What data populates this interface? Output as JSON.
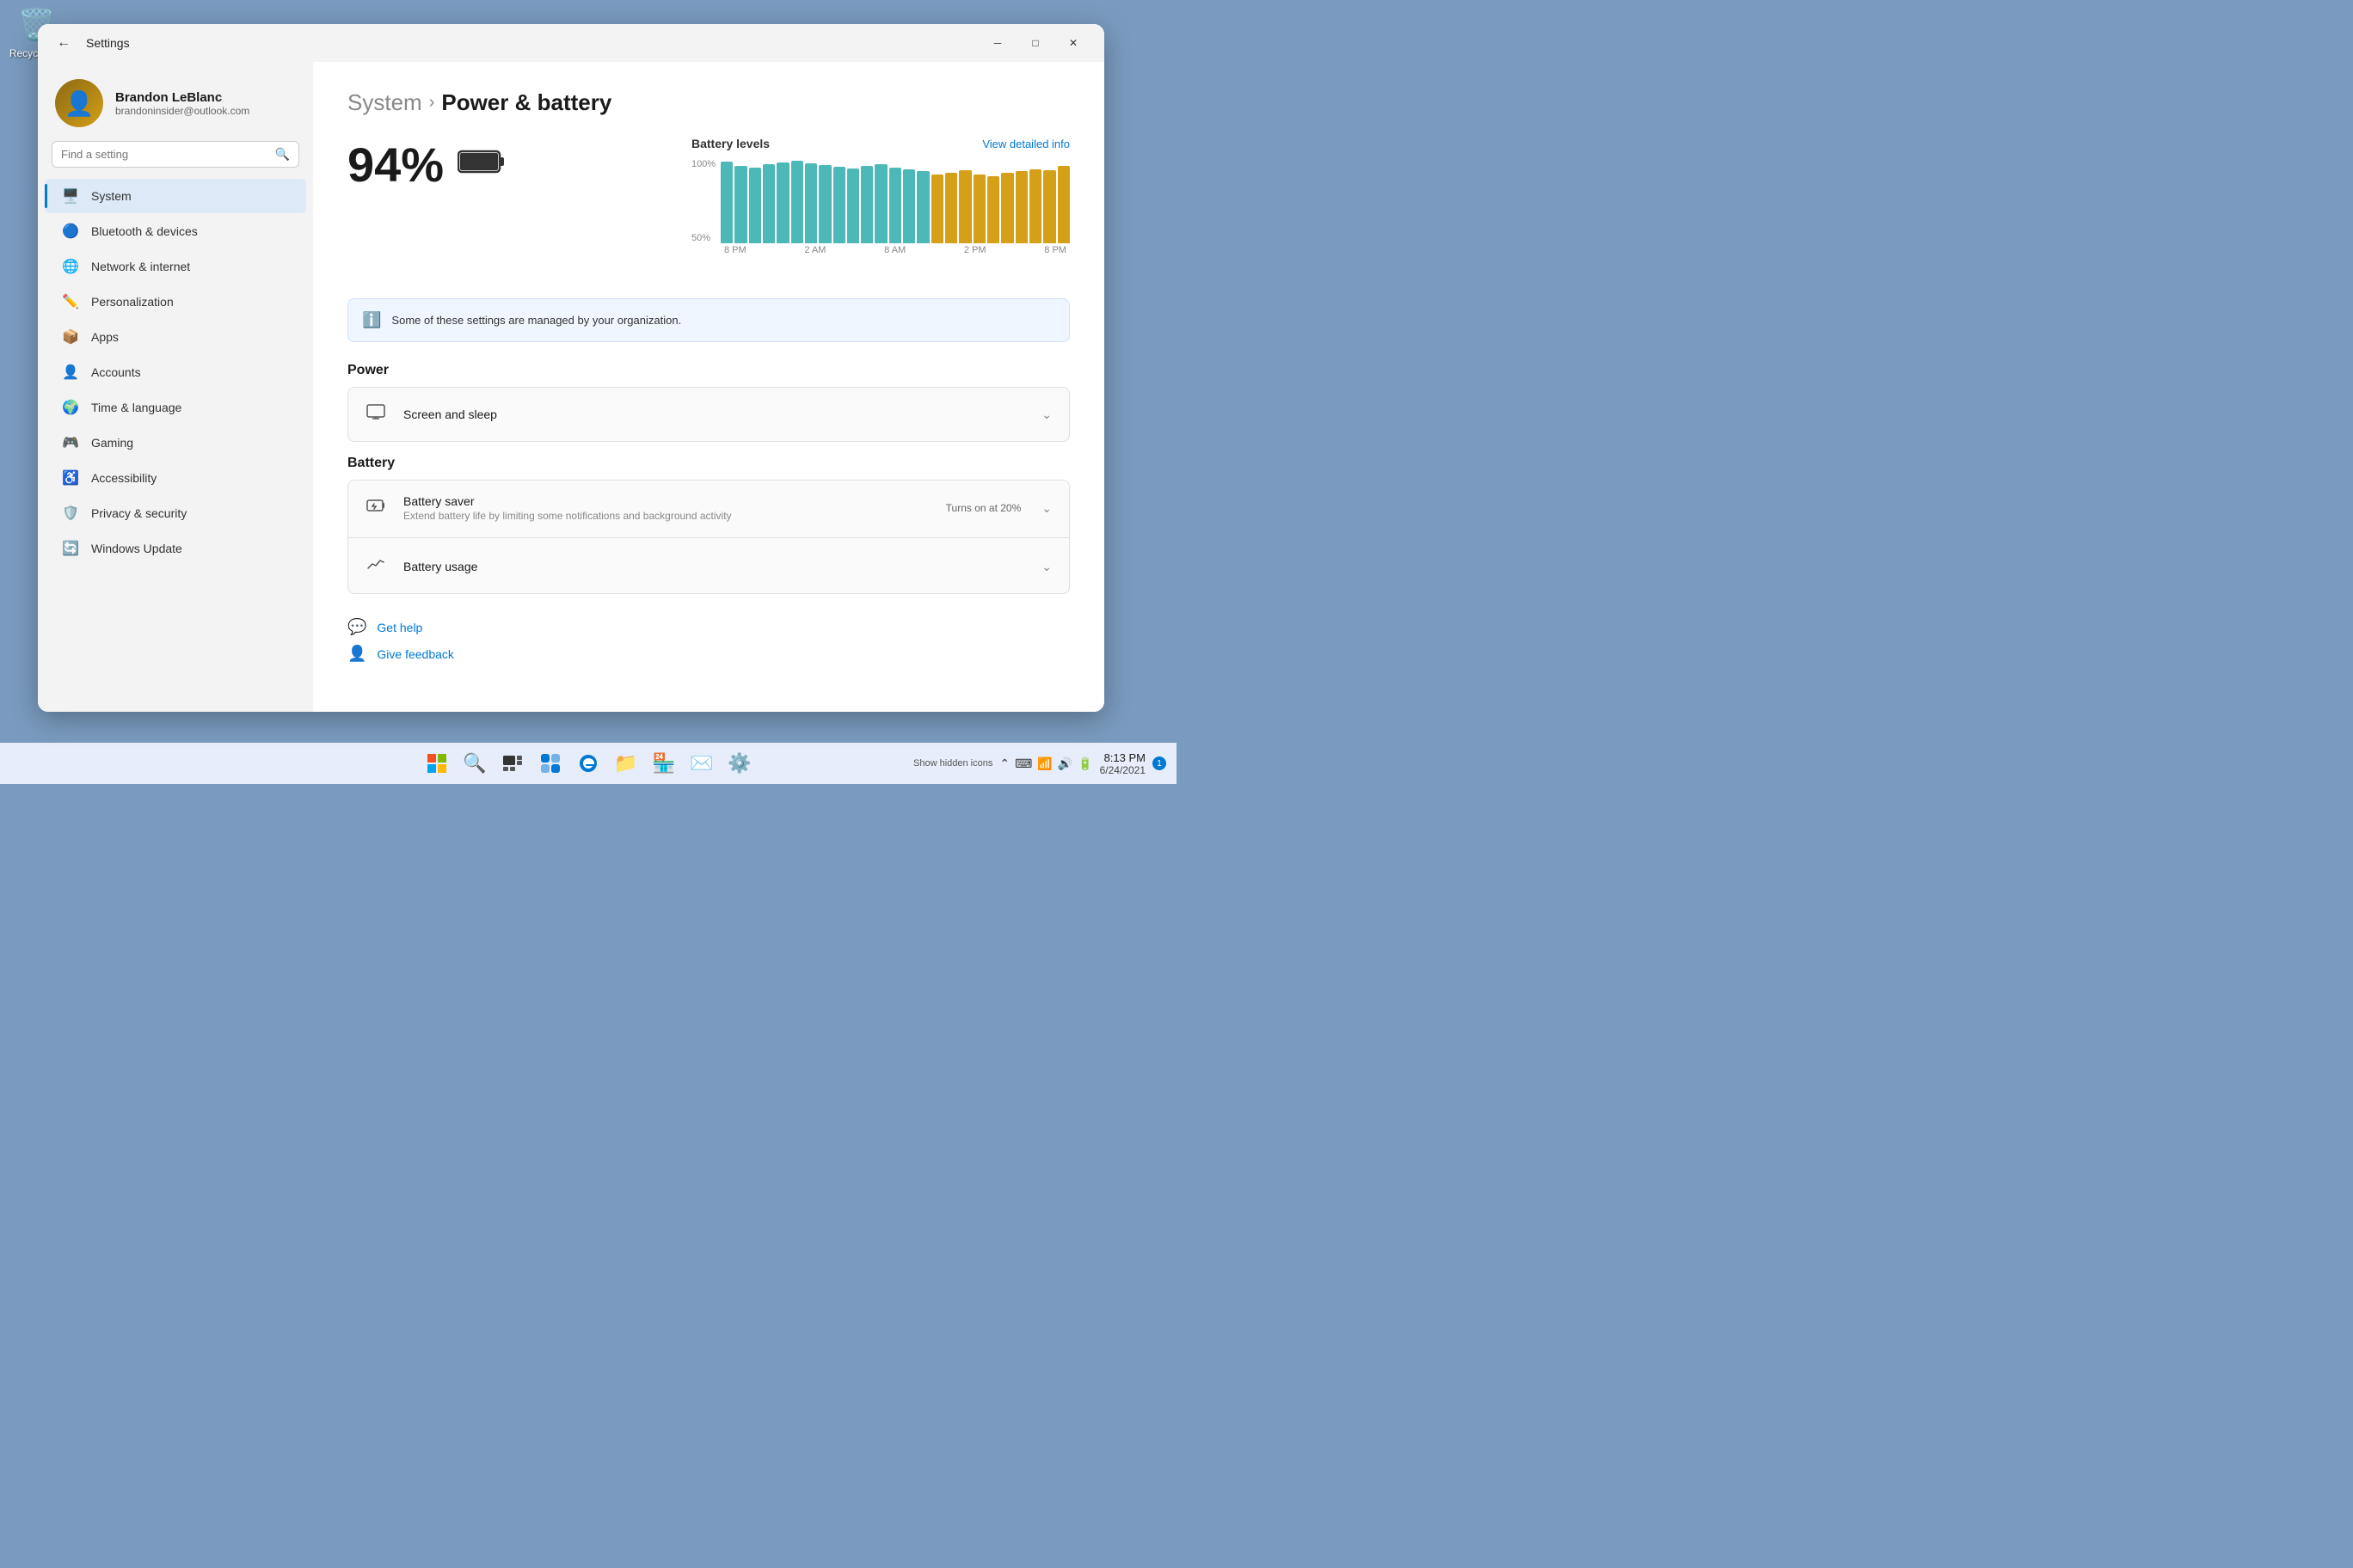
{
  "desktop": {
    "recycle_bin_label": "Recycle Bin",
    "recycle_bin_icon": "🗑️"
  },
  "window": {
    "title": "Settings",
    "controls": {
      "minimize": "─",
      "maximize": "□",
      "close": "✕"
    }
  },
  "sidebar": {
    "profile": {
      "name": "Brandon LeBlanc",
      "email": "brandoninsider@outlook.com"
    },
    "search": {
      "placeholder": "Find a setting"
    },
    "nav_items": [
      {
        "id": "system",
        "label": "System",
        "icon": "🖥️",
        "active": true
      },
      {
        "id": "bluetooth",
        "label": "Bluetooth & devices",
        "icon": "🔵"
      },
      {
        "id": "network",
        "label": "Network & internet",
        "icon": "🌐"
      },
      {
        "id": "personalization",
        "label": "Personalization",
        "icon": "✏️"
      },
      {
        "id": "apps",
        "label": "Apps",
        "icon": "📦"
      },
      {
        "id": "accounts",
        "label": "Accounts",
        "icon": "👤"
      },
      {
        "id": "time",
        "label": "Time & language",
        "icon": "🌍"
      },
      {
        "id": "gaming",
        "label": "Gaming",
        "icon": "🎮"
      },
      {
        "id": "accessibility",
        "label": "Accessibility",
        "icon": "♿"
      },
      {
        "id": "privacy",
        "label": "Privacy & security",
        "icon": "🛡️"
      },
      {
        "id": "update",
        "label": "Windows Update",
        "icon": "🔄"
      }
    ]
  },
  "content": {
    "breadcrumb": {
      "parent": "System",
      "chevron": "›",
      "current": "Power & battery"
    },
    "battery_percentage": "94%",
    "battery_icon": "🔋",
    "chart": {
      "title": "Battery levels",
      "link_text": "View detailed info",
      "x_labels": [
        "8 PM",
        "2 AM",
        "8 AM",
        "2 PM",
        "8 PM"
      ],
      "y_labels": [
        "100%",
        "50%"
      ],
      "bars": [
        {
          "height": 95,
          "type": "teal"
        },
        {
          "height": 90,
          "type": "teal"
        },
        {
          "height": 88,
          "type": "teal"
        },
        {
          "height": 92,
          "type": "teal"
        },
        {
          "height": 94,
          "type": "teal"
        },
        {
          "height": 96,
          "type": "teal"
        },
        {
          "height": 93,
          "type": "teal"
        },
        {
          "height": 91,
          "type": "teal"
        },
        {
          "height": 89,
          "type": "teal"
        },
        {
          "height": 87,
          "type": "teal"
        },
        {
          "height": 90,
          "type": "teal"
        },
        {
          "height": 92,
          "type": "teal"
        },
        {
          "height": 88,
          "type": "teal"
        },
        {
          "height": 86,
          "type": "teal"
        },
        {
          "height": 84,
          "type": "teal"
        },
        {
          "height": 80,
          "type": "yellow"
        },
        {
          "height": 82,
          "type": "yellow"
        },
        {
          "height": 85,
          "type": "yellow"
        },
        {
          "height": 80,
          "type": "yellow"
        },
        {
          "height": 78,
          "type": "yellow"
        },
        {
          "height": 82,
          "type": "yellow"
        },
        {
          "height": 84,
          "type": "yellow"
        },
        {
          "height": 86,
          "type": "yellow"
        },
        {
          "height": 85,
          "type": "yellow"
        },
        {
          "height": 90,
          "type": "yellow"
        }
      ]
    },
    "info_banner": "Some of these settings are managed by your organization.",
    "sections": [
      {
        "id": "power",
        "label": "Power",
        "items": [
          {
            "id": "screen-sleep",
            "icon": "🖥",
            "title": "Screen and sleep",
            "desc": "",
            "value": "",
            "has_chevron": true
          }
        ]
      },
      {
        "id": "battery",
        "label": "Battery",
        "items": [
          {
            "id": "battery-saver",
            "icon": "🔋",
            "title": "Battery saver",
            "desc": "Extend battery life by limiting some notifications and background activity",
            "value": "Turns on at 20%",
            "has_chevron": true
          },
          {
            "id": "battery-usage",
            "icon": "📈",
            "title": "Battery usage",
            "desc": "",
            "value": "",
            "has_chevron": true
          }
        ]
      }
    ],
    "help": [
      {
        "id": "get-help",
        "icon": "💬",
        "label": "Get help"
      },
      {
        "id": "give-feedback",
        "icon": "👤",
        "label": "Give feedback"
      }
    ]
  },
  "taskbar": {
    "icons": [
      {
        "id": "start",
        "icon": "⊞"
      },
      {
        "id": "search",
        "icon": "🔍"
      },
      {
        "id": "task-view",
        "icon": "⬛"
      },
      {
        "id": "widgets",
        "icon": "⬜"
      },
      {
        "id": "edge",
        "icon": "🌐"
      },
      {
        "id": "explorer",
        "icon": "📁"
      },
      {
        "id": "store",
        "icon": "🏪"
      },
      {
        "id": "mail",
        "icon": "✉️"
      },
      {
        "id": "settings-app",
        "icon": "⚙️"
      }
    ],
    "system_tray": {
      "hidden_icons": "Show hidden icons",
      "clock": {
        "time": "8:13 PM",
        "date": "6/24/2021"
      },
      "notification_count": "1"
    }
  }
}
